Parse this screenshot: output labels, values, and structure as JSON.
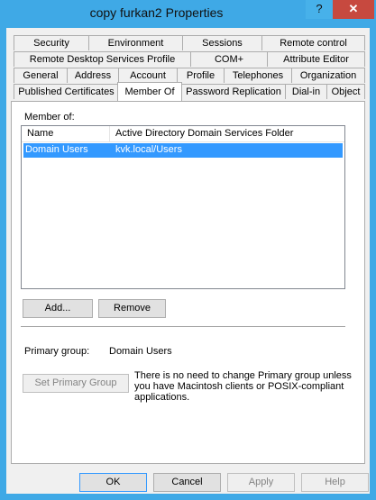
{
  "window": {
    "title": "copy furkan2 Properties",
    "help_button": "?",
    "close_button": "✕"
  },
  "tabs": {
    "row1": [
      "Security",
      "Environment",
      "Sessions",
      "Remote control"
    ],
    "row2": [
      "Remote Desktop Services Profile",
      "COM+",
      "Attribute Editor"
    ],
    "row3": [
      "General",
      "Address",
      "Account",
      "Profile",
      "Telephones",
      "Organization"
    ],
    "row4": [
      "Published Certificates",
      "Member Of",
      "Password Replication",
      "Dial-in",
      "Object"
    ],
    "active": "Member Of"
  },
  "member_of": {
    "label": "Member of:",
    "columns": [
      "Name",
      "Active Directory Domain Services Folder"
    ],
    "rows": [
      {
        "name": "Domain Users",
        "folder": "kvk.local/Users",
        "selected": true
      }
    ]
  },
  "buttons": {
    "add": "Add...",
    "remove": "Remove",
    "set_primary": "Set Primary Group",
    "ok": "OK",
    "cancel": "Cancel",
    "apply": "Apply",
    "help": "Help"
  },
  "primary_group": {
    "label": "Primary group:",
    "value": "Domain Users",
    "note_lines": [
      "There is no need to change Primary group unless",
      "you have Macintosh clients or POSIX-compliant",
      "applications."
    ]
  },
  "colors": {
    "title_bar": "#3fa9e6",
    "close_button": "#c7493f",
    "selection": "#3399ff"
  }
}
